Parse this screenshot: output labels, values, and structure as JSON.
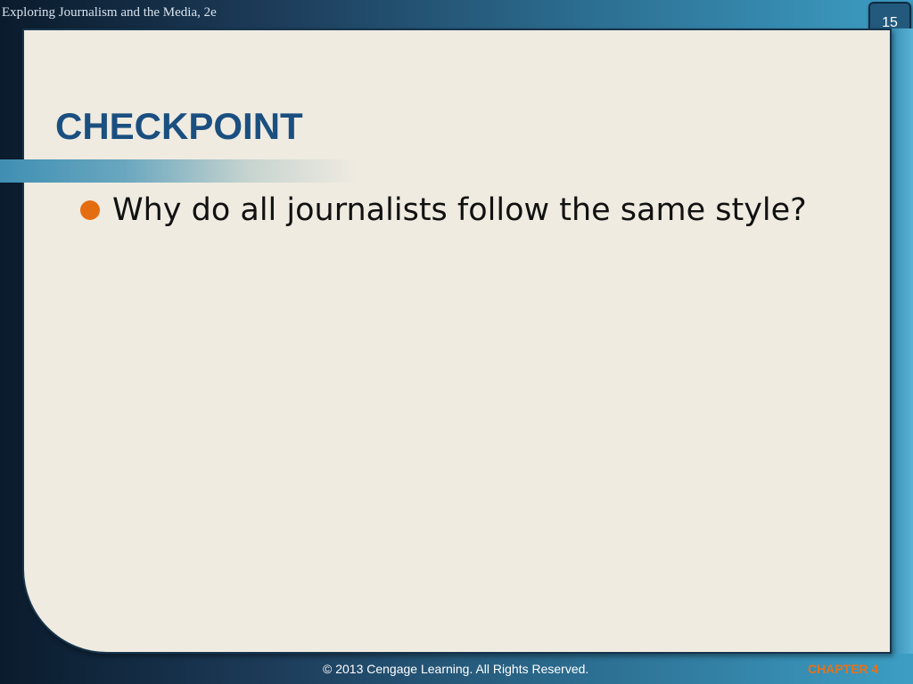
{
  "header": {
    "text": "Exploring  Journalism and the Media, 2e",
    "slide_number": "15"
  },
  "slide": {
    "title": "CHECKPOINT",
    "bullets": [
      "Why do all journalists follow the same style?"
    ]
  },
  "footer": {
    "copyright": "© 2013 Cengage Learning. All Rights Reserved.",
    "chapter": "CHAPTER 4"
  },
  "colors": {
    "title": "#1a4f80",
    "bullet": "#e56d11",
    "chapter": "#e5721a",
    "panel": "#efebe1"
  }
}
